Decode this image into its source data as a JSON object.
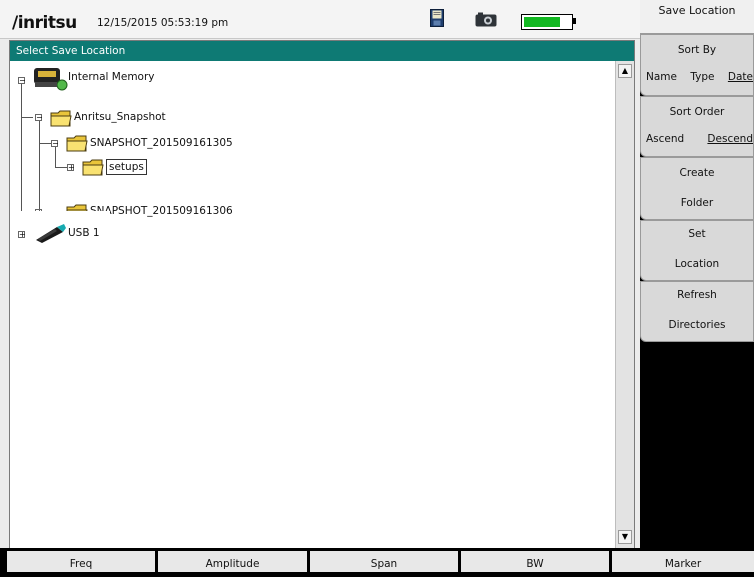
{
  "status": {
    "logo": "/inritsu",
    "datetime": "12/15/2015 05:53:19 pm",
    "battery_level": 0.78,
    "battery_color": "#12b821"
  },
  "window": {
    "title": "Select Save Location",
    "title_color": "#0e7a74"
  },
  "tree": {
    "internal_memory": "Internal Memory",
    "anritsu_snapshot": "Anritsu_Snapshot",
    "snapshot1": "SNAPSHOT_201509161305",
    "setups": "setups",
    "snapshot2": "SNAPSHOT_201509161306",
    "usb": "USB 1",
    "collapse_symbol": "−",
    "expand_symbol": "+"
  },
  "scroll": {
    "up": "▲",
    "down": "▼"
  },
  "softkeys": {
    "title": "Save Location",
    "sort_by": "Sort By",
    "sort_name": "Name",
    "sort_type": "Type",
    "sort_date": "Date",
    "sort_order": "Sort Order",
    "ascend": "Ascend",
    "descend": "Descend",
    "create": "Create",
    "folder": "Folder",
    "set": "Set",
    "location": "Location",
    "refresh": "Refresh",
    "directories": "Directories"
  },
  "bottom": {
    "freq": "Freq",
    "amplitude": "Amplitude",
    "span": "Span",
    "bw": "BW",
    "marker": "Marker"
  }
}
